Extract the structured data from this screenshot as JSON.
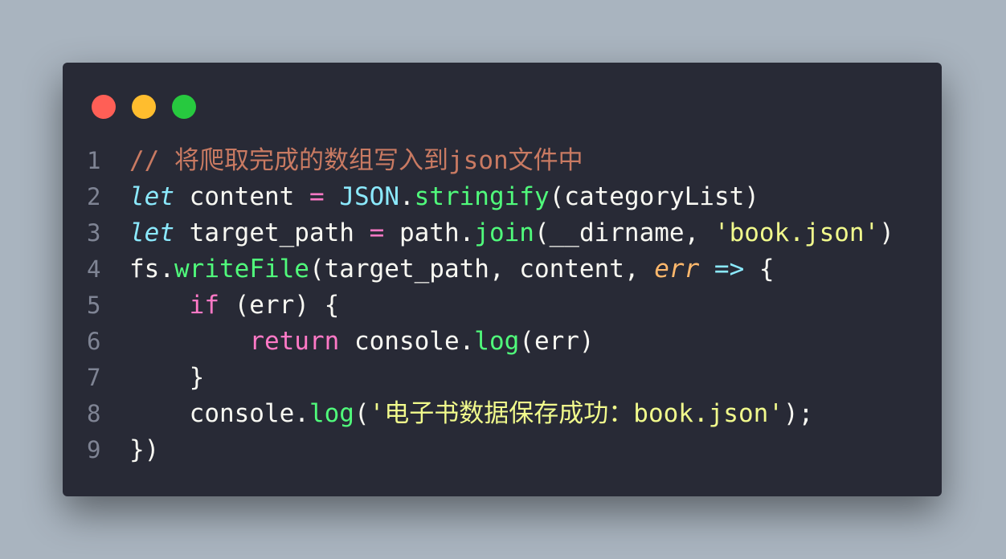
{
  "colors": {
    "background": "#a9b4bf",
    "window": "#282a36",
    "dot_close": "#ff5f56",
    "dot_minimize": "#ffbd2e",
    "dot_maximize": "#27c93f"
  },
  "code": {
    "lines": [
      {
        "number": "1",
        "tokens": [
          {
            "type": "comment",
            "text": "// 将爬取完成的数组写入到json文件中"
          }
        ]
      },
      {
        "number": "2",
        "tokens": [
          {
            "type": "keyword-italic",
            "text": "let"
          },
          {
            "type": "plain",
            "text": " content "
          },
          {
            "type": "op",
            "text": "="
          },
          {
            "type": "plain",
            "text": " "
          },
          {
            "type": "builtin",
            "text": "JSON"
          },
          {
            "type": "plain",
            "text": "."
          },
          {
            "type": "func",
            "text": "stringify"
          },
          {
            "type": "plain",
            "text": "(categoryList)"
          }
        ]
      },
      {
        "number": "3",
        "tokens": [
          {
            "type": "keyword-italic",
            "text": "let"
          },
          {
            "type": "plain",
            "text": " target_path "
          },
          {
            "type": "op",
            "text": "="
          },
          {
            "type": "plain",
            "text": " path."
          },
          {
            "type": "func",
            "text": "join"
          },
          {
            "type": "plain",
            "text": "(__dirname, "
          },
          {
            "type": "string",
            "text": "'book.json'"
          },
          {
            "type": "plain",
            "text": ")"
          }
        ]
      },
      {
        "number": "4",
        "tokens": [
          {
            "type": "plain",
            "text": "fs."
          },
          {
            "type": "func",
            "text": "writeFile"
          },
          {
            "type": "plain",
            "text": "(target_path, content, "
          },
          {
            "type": "param",
            "text": "err"
          },
          {
            "type": "plain",
            "text": " "
          },
          {
            "type": "arrow",
            "text": "=>"
          },
          {
            "type": "plain",
            "text": " {"
          }
        ]
      },
      {
        "number": "5",
        "tokens": [
          {
            "type": "plain",
            "text": "    "
          },
          {
            "type": "control",
            "text": "if"
          },
          {
            "type": "plain",
            "text": " (err) {"
          }
        ]
      },
      {
        "number": "6",
        "tokens": [
          {
            "type": "plain",
            "text": "        "
          },
          {
            "type": "control",
            "text": "return"
          },
          {
            "type": "plain",
            "text": " console."
          },
          {
            "type": "func",
            "text": "log"
          },
          {
            "type": "plain",
            "text": "(err)"
          }
        ]
      },
      {
        "number": "7",
        "tokens": [
          {
            "type": "plain",
            "text": "    }"
          }
        ]
      },
      {
        "number": "8",
        "tokens": [
          {
            "type": "plain",
            "text": "    console."
          },
          {
            "type": "func",
            "text": "log"
          },
          {
            "type": "plain",
            "text": "("
          },
          {
            "type": "string",
            "text": "'电子书数据保存成功：book.json'"
          },
          {
            "type": "plain",
            "text": ");"
          }
        ]
      },
      {
        "number": "9",
        "tokens": [
          {
            "type": "plain",
            "text": "})"
          }
        ]
      }
    ]
  }
}
